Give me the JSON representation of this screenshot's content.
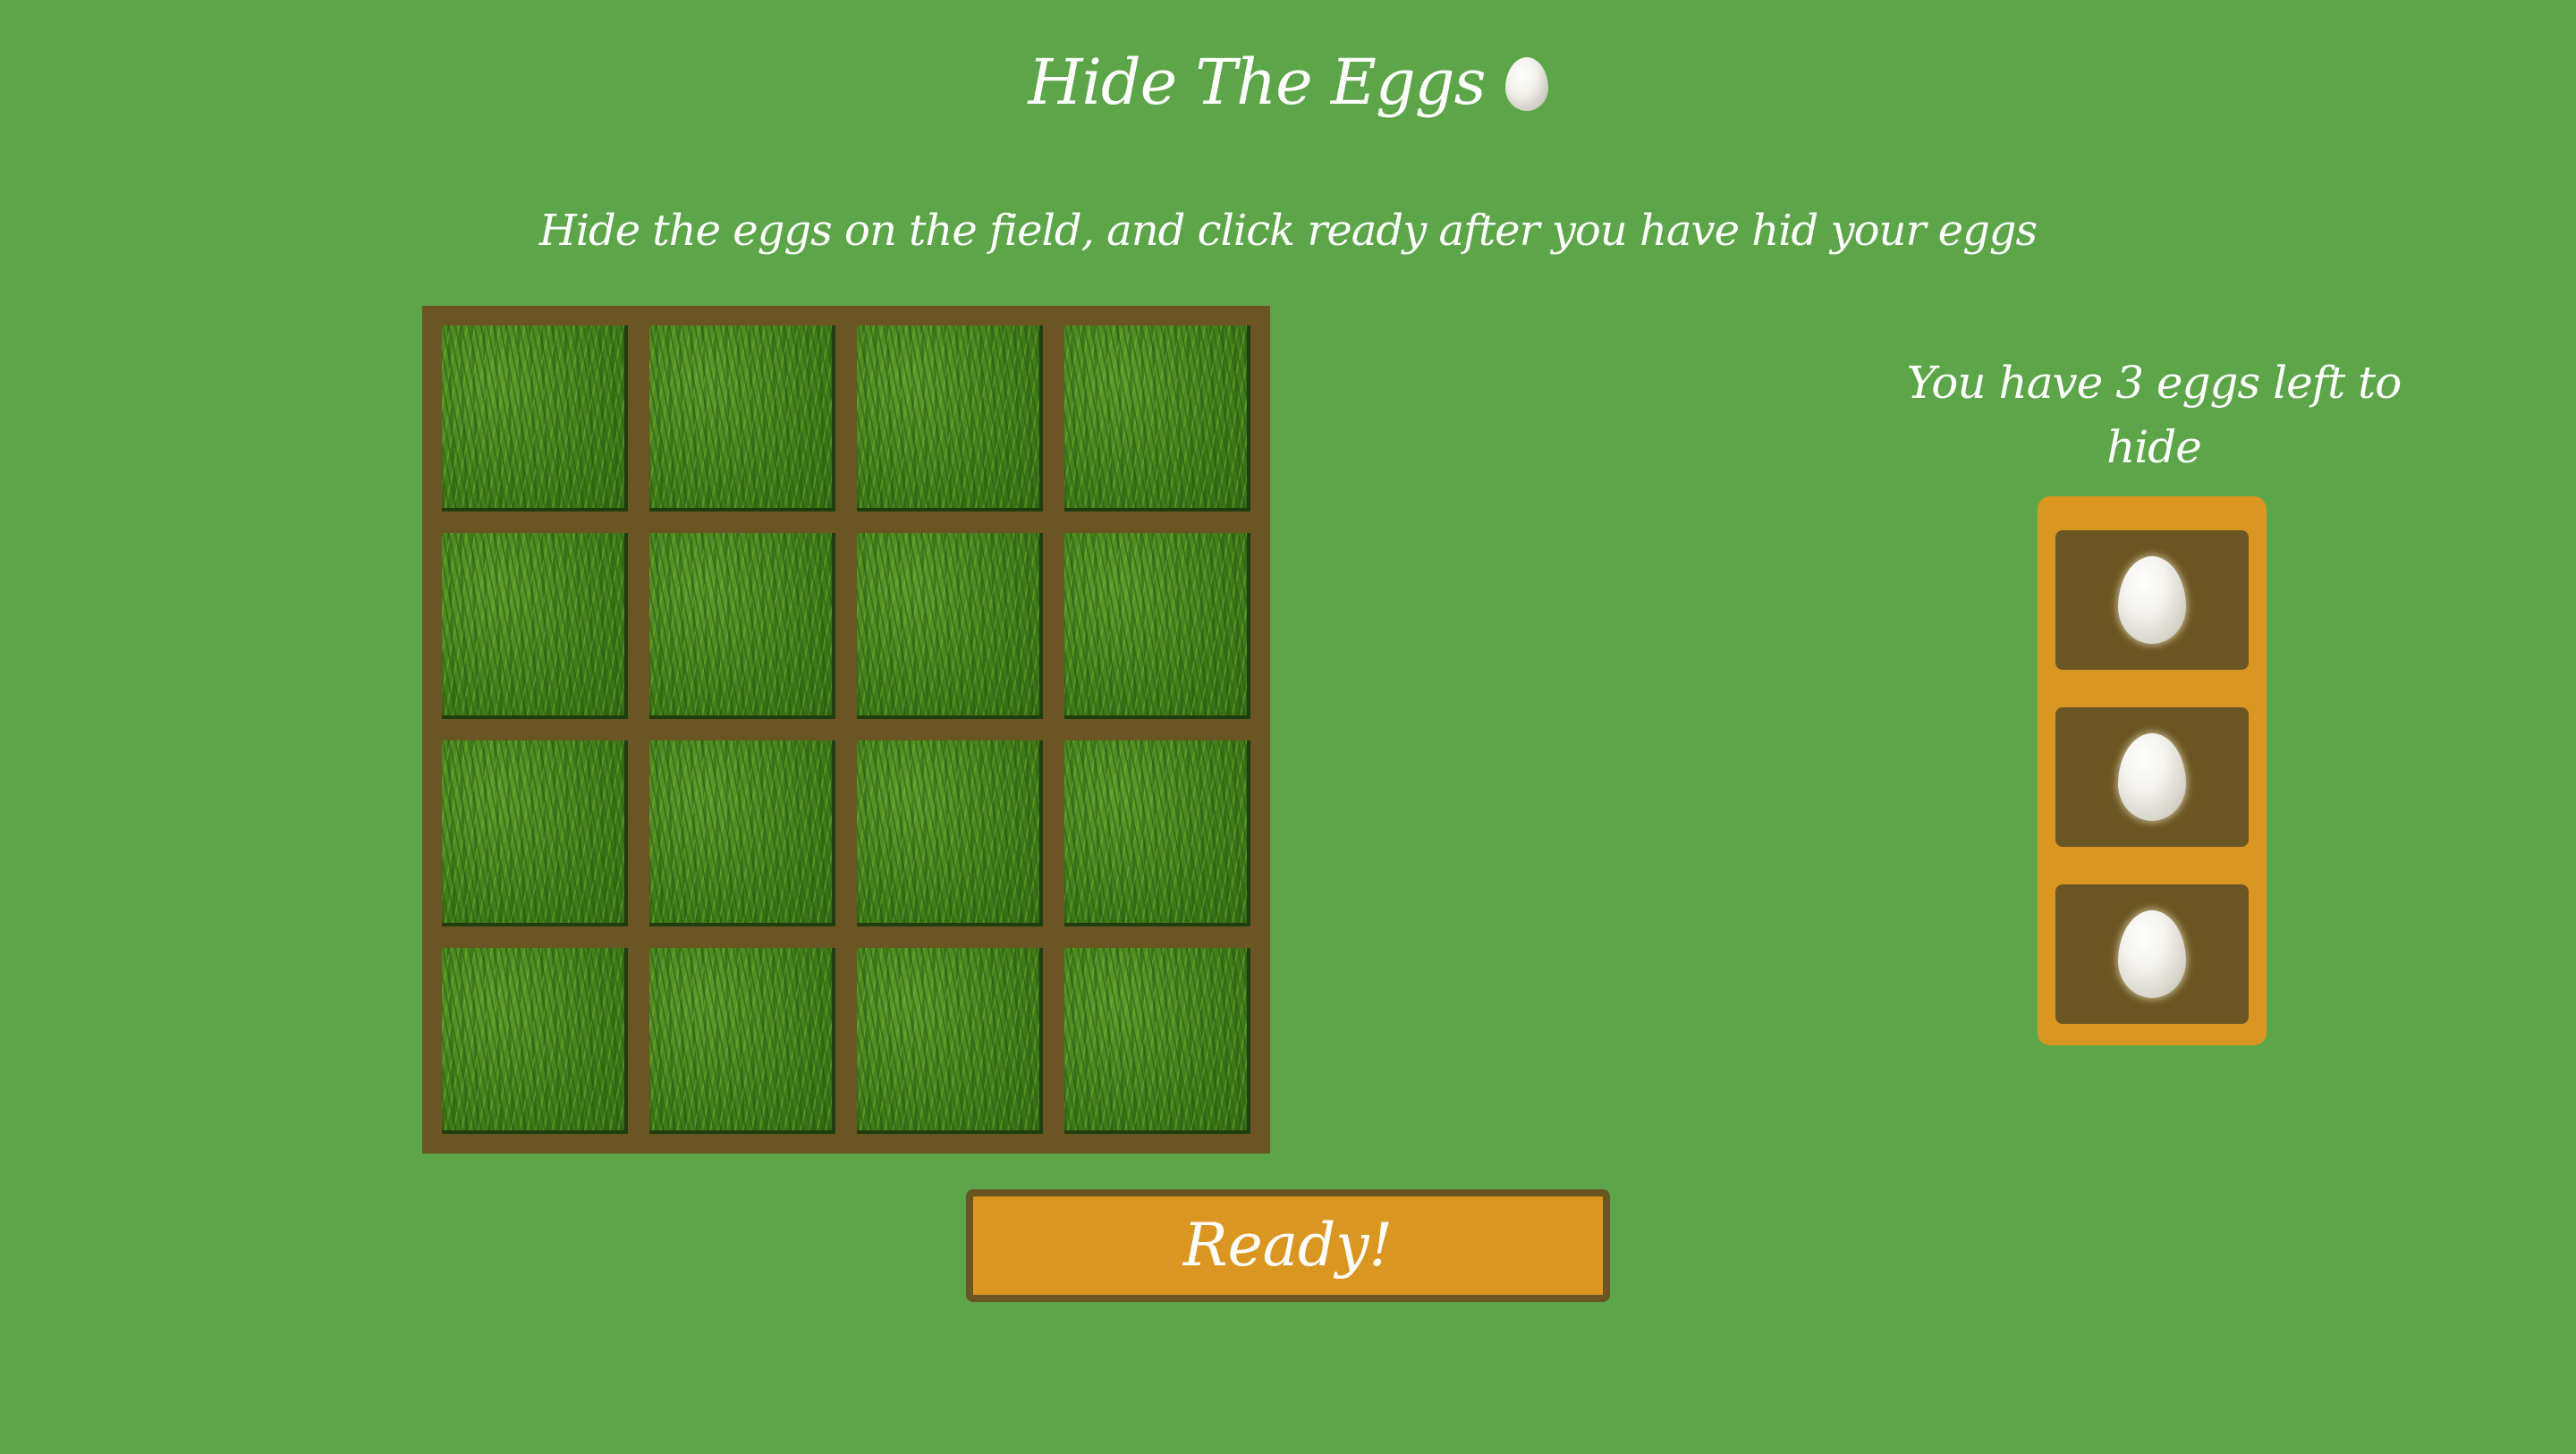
{
  "header": {
    "title": "Hide The Eggs",
    "title_icon": "egg-icon",
    "instructions": "Hide the eggs on the field, and click ready after you have hid your eggs"
  },
  "field": {
    "rows": 4,
    "columns": 4,
    "tile_texture": "grass"
  },
  "status": {
    "eggs_left_text": "You have 3 eggs left to hide",
    "eggs_remaining": 3
  },
  "tray": {
    "eggs": [
      "egg",
      "egg",
      "egg"
    ]
  },
  "actions": {
    "ready_label": "Ready!"
  },
  "colors": {
    "background": "#5ca548",
    "field_frame": "#6b5623",
    "tray": "#db9622",
    "button": "#db9622"
  }
}
